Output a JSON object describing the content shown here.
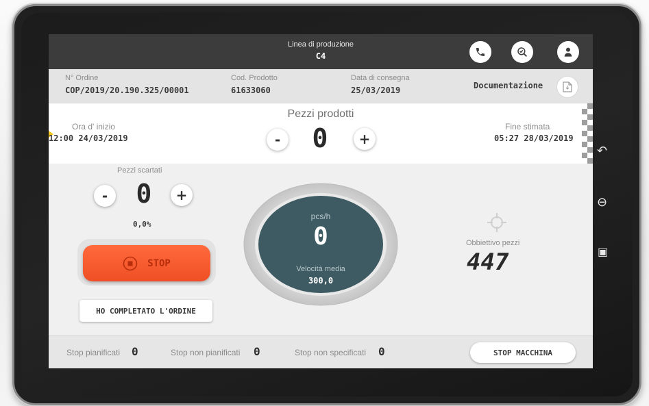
{
  "header": {
    "title": "Linea di produzione",
    "line": "C4",
    "icons": [
      "phone-icon",
      "check-search-icon",
      "user-icon"
    ]
  },
  "order": {
    "order_label": "N° Ordine",
    "order_value": "COP/2019/20.190.325/00001",
    "product_label": "Cod. Prodotto",
    "product_value": "61633060",
    "delivery_label": "Data di consegna",
    "delivery_value": "25/03/2019",
    "doc_label": "Documentazione"
  },
  "production": {
    "title": "Pezzi prodotti",
    "count": "0",
    "minus": "-",
    "plus": "+",
    "start_label": "Ora d' inizio",
    "start_value": "12:00 24/03/2019",
    "end_label": "Fine stimata",
    "end_value": "05:27 28/03/2019"
  },
  "scrap": {
    "title": "Pezzi scartati",
    "count": "0",
    "percent": "0,0%",
    "minus": "-",
    "plus": "+"
  },
  "actions": {
    "stop_label": "STOP",
    "complete_label": "HO COMPLETATO L'ORDINE",
    "stop_machine_label": "STOP MACCHINA"
  },
  "gauge": {
    "unit": "pcs/h",
    "value": "0",
    "avg_label": "Velocità media",
    "avg_value": "300,0"
  },
  "target": {
    "label": "Obbiettivo pezzi",
    "value": "447"
  },
  "stops": {
    "planned_label": "Stop pianificati",
    "planned_value": "0",
    "unplanned_label": "Stop non pianificati",
    "unplanned_value": "0",
    "unspecified_label": "Stop non specificati",
    "unspecified_value": "0"
  },
  "colors": {
    "topbar": "#3c3c3c",
    "stop_button": "#ef4f24",
    "gauge_fill": "#3e5a63",
    "target_icon": "#cfcfcf"
  }
}
